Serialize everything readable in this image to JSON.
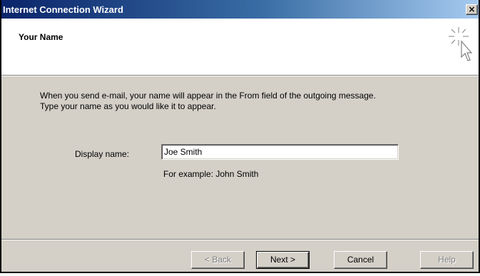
{
  "window": {
    "title": "Internet Connection Wizard",
    "close_glyph": "×"
  },
  "header": {
    "heading": "Your Name",
    "icon": "wizard-cursor-sparkle-icon"
  },
  "body": {
    "instruction_line1": "When you send e-mail, your name will appear in the From field of the outgoing message.",
    "instruction_line2": "Type your name as you would like it to appear.",
    "display_name_label": "Display name:",
    "display_name_value": "Joe Smith",
    "example_text": "For example: John Smith"
  },
  "buttons": {
    "back": "< Back",
    "next": "Next >",
    "cancel": "Cancel",
    "help": "Help"
  },
  "colors": {
    "titlebar_start": "#0a246a",
    "titlebar_end": "#a6caf0",
    "dialog_face": "#d4d0c8"
  }
}
